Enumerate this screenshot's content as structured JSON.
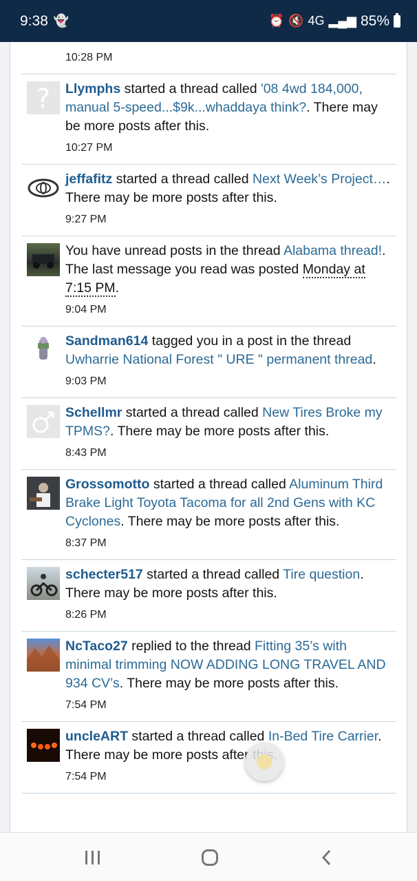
{
  "status_bar": {
    "time": "9:38",
    "network": "4G",
    "battery": "85%"
  },
  "feed": {
    "partial_time": "10:28 PM",
    "items": [
      {
        "user": "Llymphs",
        "action": " started a thread called ",
        "link": "'08 4wd 184,000, manual 5-speed...$9k...whaddaya think?",
        "suffix": ". There may be more posts after this.",
        "time": "10:27 PM"
      },
      {
        "user": "jeffafitz",
        "action": " started a thread called ",
        "link": "Next Week’s Project…",
        "suffix": ". There may be more posts after this.",
        "time": "9:27 PM"
      },
      {
        "prefix": "You have unread posts in the thread ",
        "link": "Alabama thread!",
        "suffix": ". The last message you read was posted ",
        "date": "Monday at 7:15 PM",
        "end": ".",
        "time": "9:04 PM"
      },
      {
        "user": "Sandman614",
        "action": " tagged you in a post in the thread ",
        "link": "Uwharrie National Forest \" URE \" permanent thread",
        "suffix": ".",
        "time": "9:03 PM"
      },
      {
        "user": "Schellmr",
        "action": " started a thread called ",
        "link": "New Tires Broke my TPMS?",
        "suffix": ". There may be more posts after this.",
        "time": "8:43 PM"
      },
      {
        "user": "Grossomotto",
        "action": " started a thread called ",
        "link": "Aluminum Third Brake Light Toyota Tacoma for all 2nd Gens with KC Cyclones",
        "suffix": ". There may be more posts after this.",
        "time": "8:37 PM"
      },
      {
        "user": "schecter517",
        "action": " started a thread called ",
        "link": "Tire question",
        "suffix": ". There may be more posts after this.",
        "time": "8:26 PM"
      },
      {
        "user": "NcTaco27",
        "action": " replied to the thread ",
        "link": "Fitting 35’s with minimal trimming NOW ADDING LONG TRAVEL AND 934 CV’s",
        "suffix": ". There may be more posts after this.",
        "time": "7:54 PM"
      },
      {
        "user": "uncleART",
        "action": " started a thread called ",
        "link": "In-Bed Tire Carrier",
        "suffix": ". There may be more posts after this.",
        "time": "7:54 PM"
      }
    ]
  },
  "icons": {
    "recents": "recents-icon",
    "home": "home-icon",
    "back": "back-icon"
  }
}
